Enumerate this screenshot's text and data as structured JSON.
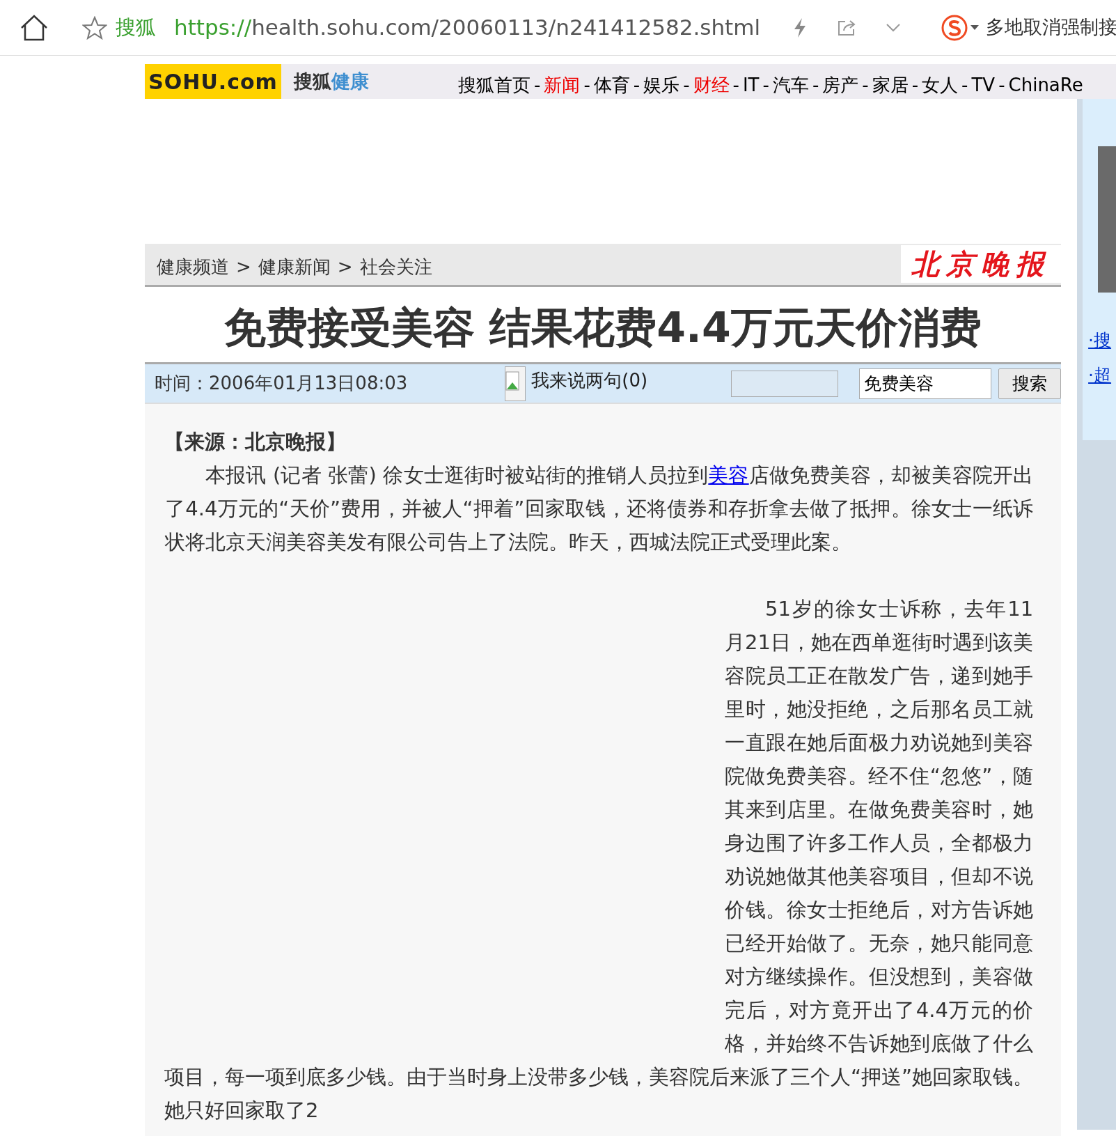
{
  "browser": {
    "site_name": "搜狐",
    "url_scheme": "https://",
    "url_rest": "health.sohu.com/20060113/n241412582.shtml",
    "news_ticker": "多地取消强制接"
  },
  "header": {
    "logo_text": "SOHU.com",
    "channel_brand": "搜狐",
    "channel_name": "健康",
    "nav": [
      {
        "label": "搜狐首页",
        "highlight": false
      },
      {
        "label": "新闻",
        "highlight": true
      },
      {
        "label": "体育",
        "highlight": false
      },
      {
        "label": "娱乐",
        "highlight": false
      },
      {
        "label": "财经",
        "highlight": true
      },
      {
        "label": "IT",
        "highlight": false
      },
      {
        "label": "汽车",
        "highlight": false
      },
      {
        "label": "房产",
        "highlight": false
      },
      {
        "label": "家居",
        "highlight": false
      },
      {
        "label": "女人",
        "highlight": false
      },
      {
        "label": "TV",
        "highlight": false
      },
      {
        "label": "ChinaRe",
        "highlight": false
      }
    ],
    "nav_separator": "-"
  },
  "breadcrumb": {
    "items": [
      "健康频道",
      "健康新闻",
      "社会关注"
    ],
    "separator": ">",
    "source_logo": "北京晚报"
  },
  "article": {
    "title": "免费接受美容 结果花费4.4万元天价消费",
    "time": "时间：2006年01月13日08:03",
    "comment_link": "我来说两句(0)",
    "search": {
      "value": "免费美容",
      "button": "搜索"
    },
    "source": "【来源：北京晚报】",
    "paragraphs": [
      [
        {
          "text": "本报讯 (记者 张蕾) 徐女士逛街时被站街的推销人员拉到",
          "kind": "text"
        },
        {
          "text": "美容",
          "kind": "link"
        },
        {
          "text": "店做免费美容，却被美容院开出了4.4万元的“天价”费用，并被人“押着”回家取钱，还将债券和存折拿去做了抵押。徐女士一纸诉状将北京天润美容美发有限公司告上了法院。昨天，西城法院正式受理此案。",
          "kind": "text"
        }
      ],
      [
        {
          "text": "51岁的徐女士诉称，去年11月21日，她在西单逛街时遇到该美容院员工正在散发广告，递到她手里时，她没拒绝，之后那名员工就一直跟在她后面极力劝说她到美容院做免费美容。经不住“忽悠”，随其来到店里。在做免费美容时，她身边围了许多工作人员，全都极力劝说她做其他美容项目，但却不说价钱。徐女士拒绝后，对方告诉她已经开始做了。无奈，她只能同意对方继续操作。但没想到，美容做完后，对方竟开出了4.4万元的价格，并始终不告诉她到底做了什么项目，每一项到底多少钱。由于当时身上没带多少钱，美容院后来派了三个人“押送”她回家取钱。她只好回家取了2",
          "kind": "text"
        }
      ]
    ]
  },
  "sidebar": {
    "links": [
      "·搜",
      "·超"
    ]
  }
}
